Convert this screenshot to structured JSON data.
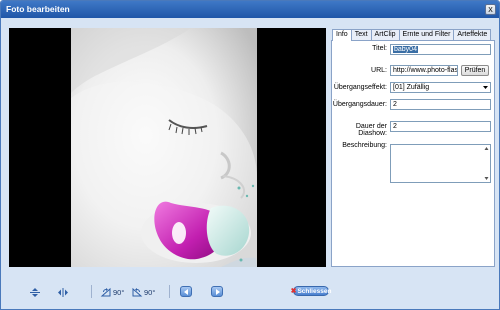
{
  "window": {
    "title": "Foto bearbeiten",
    "close_label": "x"
  },
  "toolbar": {
    "rotate_left_label": "90°",
    "rotate_right_label": "90°",
    "close_label": "Schliessen"
  },
  "tabs": [
    {
      "label": "Info",
      "active": true
    },
    {
      "label": "Text",
      "active": false
    },
    {
      "label": "ArtClip",
      "active": false
    },
    {
      "label": "Ernte und Filter",
      "active": false
    },
    {
      "label": "Arteffekte",
      "active": false
    }
  ],
  "form": {
    "titel_label": "Titel:",
    "titel_value": "baby04",
    "url_label": "URL:",
    "url_value": "http://www.photo-flash-",
    "pruefen_label": "Prüfen",
    "uebergang_label": "Übergangseffekt:",
    "uebergang_value": "[01] Zufällig",
    "uebergangsdauer_label": "Übergangsdauer:",
    "uebergangsdauer_value": "2",
    "diashow_label": "Dauer der Diashow:",
    "diashow_value": "2",
    "beschreibung_label": "Beschreibung:",
    "beschreibung_value": ""
  }
}
